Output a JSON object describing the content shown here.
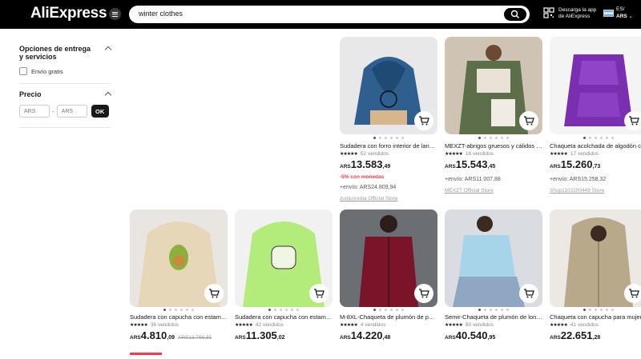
{
  "header": {
    "logo": "AliExpress",
    "search_value": "winter clothes",
    "app_text_1": "Descarga la app",
    "app_text_2": "de AliExpress",
    "lang": "ES/",
    "currency": "ARS"
  },
  "sidebar": {
    "delivery_title": "Opciones de entrega y servicios",
    "free_shipping": "Envío gratis",
    "price_title": "Precio",
    "min_placeholder": "ARS",
    "max_placeholder": "ARS",
    "ok": "OK"
  },
  "products": [
    {
      "title": "Sudadera con forro interior de lana...",
      "sold": "52 vendidos",
      "cur": "ARS",
      "int": "13.583",
      "dec": ",49",
      "old": "",
      "promo": "-5% con monedas",
      "ship": "+envío: ARS24.809,94",
      "store": "zuolunouba Official Store"
    },
    {
      "title": "MEXZT-abrigos gruesos y cálidos de...",
      "sold": "16 vendidos",
      "cur": "ARS",
      "int": "15.543",
      "dec": ",45",
      "old": "",
      "promo": "",
      "ship": "+envío: ARS11.007,88",
      "store": "MEXZT Official Store"
    },
    {
      "title": "Chaqueta acolchada de algodón co...",
      "sold": "17 vendidos",
      "cur": "ARS",
      "int": "15.260",
      "dec": ",73",
      "old": "",
      "promo": "",
      "ship": "+envío: ARS15.258,32",
      "store": "Shop1103100449 Store"
    },
    {
      "title": "Sudadera con capucha con estamp...",
      "sold": "36 vendidos",
      "cur": "ARS",
      "int": "4.810",
      "dec": ",09",
      "old": "ARS13.766,81",
      "promo": "",
      "ship": "",
      "store": ""
    },
    {
      "title": "Sudadera con capucha con estamp...",
      "sold": "42 vendidos",
      "cur": "ARS",
      "int": "11.305",
      "dec": ",02",
      "old": "",
      "promo": "",
      "ship": "",
      "store": ""
    },
    {
      "title": "M-8XL-Chaqueta de plumón de pat...",
      "sold": "4 vendidos",
      "cur": "ARS",
      "int": "14.220",
      "dec": ",48",
      "old": "",
      "promo": "",
      "ship": "",
      "store": ""
    },
    {
      "title": "Semir-Chaqueta de plumón de long...",
      "sold": "80 vendidos",
      "cur": "ARS",
      "int": "40.540",
      "dec": ",95",
      "old": "",
      "promo": "",
      "ship": "",
      "store": ""
    },
    {
      "title": "Chaqueta con capucha para mujer...",
      "sold": "41 vendidos",
      "cur": "ARS",
      "int": "22.651",
      "dec": ",28",
      "old": "",
      "promo": "",
      "ship": "",
      "store": ""
    }
  ],
  "colors": {
    "header_bg": "#000000",
    "promo_red": "#fd384f"
  }
}
